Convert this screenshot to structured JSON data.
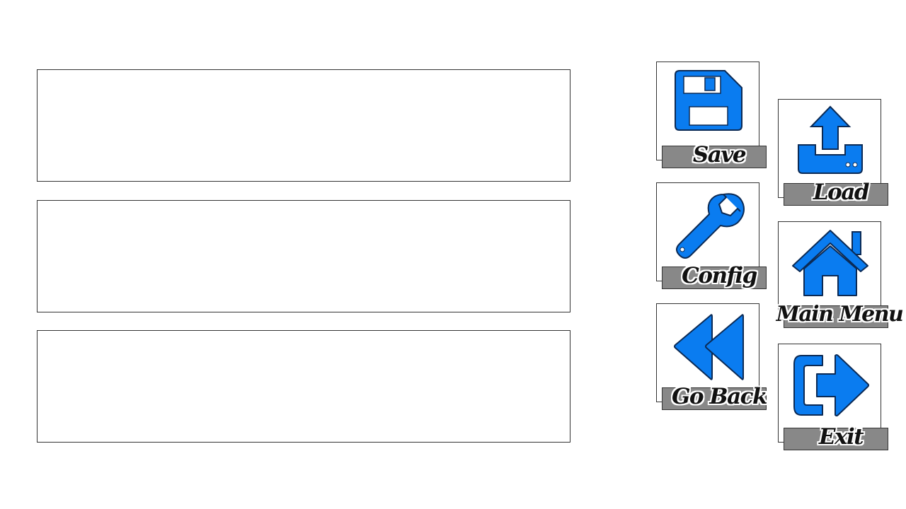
{
  "slots": [
    {
      "id": 1
    },
    {
      "id": 2
    },
    {
      "id": 3
    }
  ],
  "menu": {
    "save": {
      "label": "Save",
      "icon": "floppy-disk-icon"
    },
    "load": {
      "label": "Load",
      "icon": "upload-icon"
    },
    "config": {
      "label": "Config",
      "icon": "wrench-icon"
    },
    "main_menu": {
      "label": "Main Menu",
      "icon": "home-icon"
    },
    "go_back": {
      "label": "Go Back",
      "icon": "rewind-icon"
    },
    "exit": {
      "label": "Exit",
      "icon": "exit-icon"
    }
  },
  "colors": {
    "icon_fill": "#0a7cf0",
    "icon_stroke": "#0b2a55",
    "label_bar": "#888888",
    "border": "#333333"
  }
}
